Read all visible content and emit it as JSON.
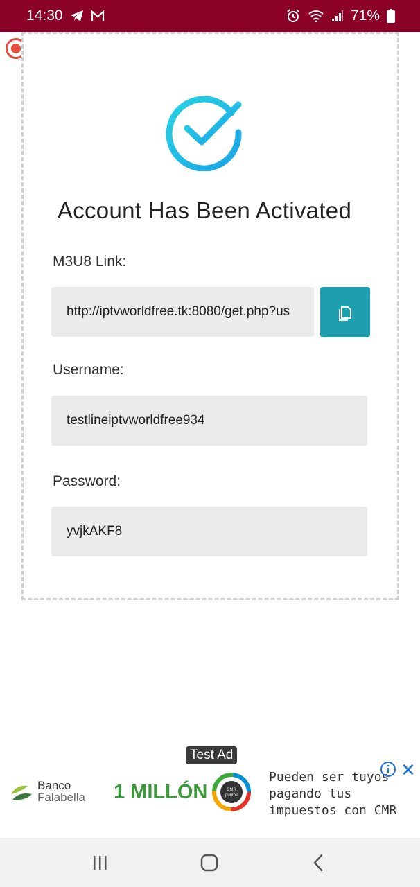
{
  "status_bar": {
    "time": "14:30",
    "battery": "71%"
  },
  "page": {
    "title": "Account Has Been Activated",
    "m3u8": {
      "label": "M3U8 Link:",
      "value": "http://iptvworldfree.tk:8080/get.php?us"
    },
    "username": {
      "label": "Username:",
      "value": "testlineiptvworldfree934"
    },
    "password": {
      "label": "Password:",
      "value": "yvjkAKF8"
    }
  },
  "ad": {
    "tag": "Test Ad",
    "brand_line1": "Banco",
    "brand_line2": "Falabella",
    "headline": "1 MILLÓN",
    "badge_line1": "CMR",
    "badge_line2": "puntos",
    "copy_line1": "Pueden ser tuyos",
    "copy_line2": "pagando tus",
    "copy_line3": "impuestos con CMR"
  },
  "colors": {
    "status_bar": "#8c0128",
    "accent": "#1e9fb0",
    "check_gradient_start": "#27d3e3",
    "check_gradient_end": "#1aa3e8"
  }
}
